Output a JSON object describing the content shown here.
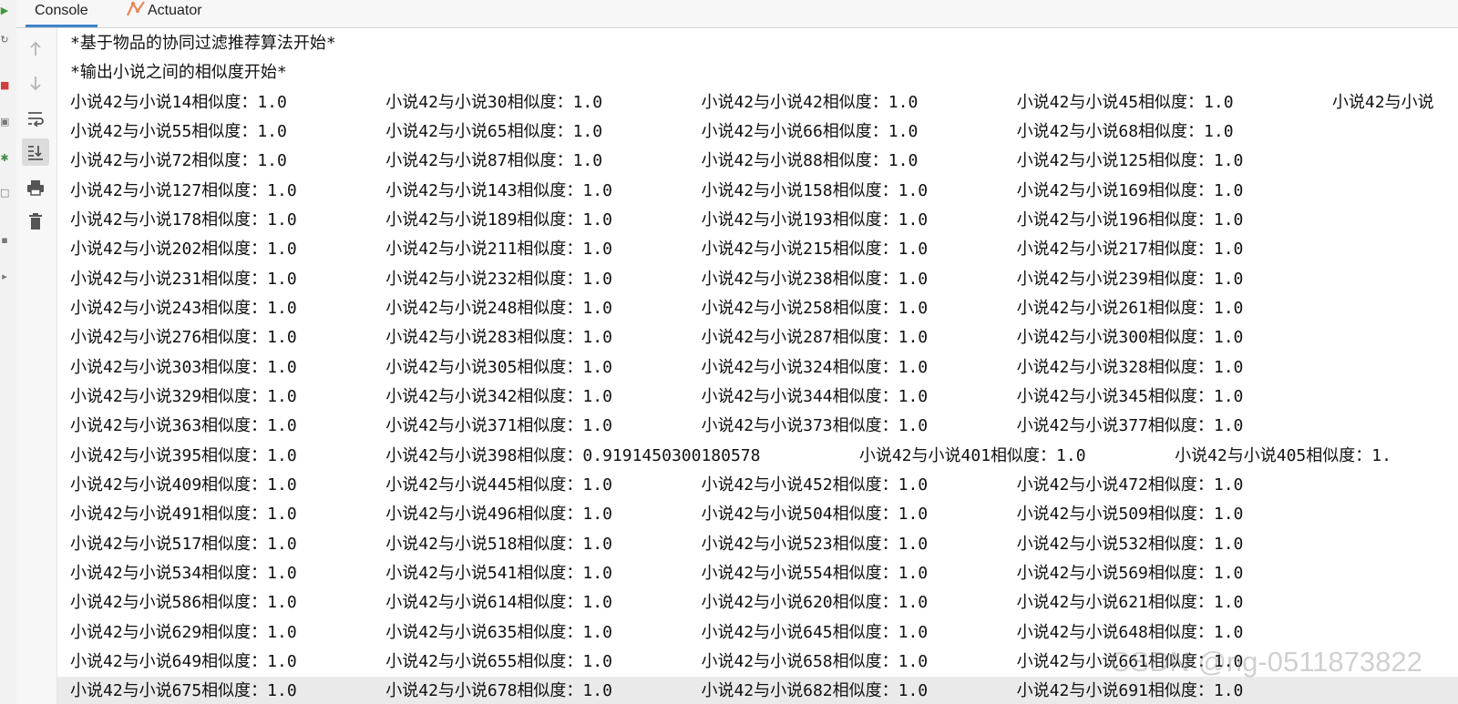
{
  "tabs": [
    {
      "label": "Console",
      "active": true,
      "icon": null
    },
    {
      "label": "Actuator",
      "active": false,
      "icon": "actuator-icon"
    }
  ],
  "toolbar": {
    "items": [
      {
        "name": "scroll-up-icon",
        "active": false
      },
      {
        "name": "scroll-down-icon",
        "active": false
      },
      {
        "name": "soft-wrap-icon",
        "active": false
      },
      {
        "name": "scroll-to-end-icon",
        "active": true
      },
      {
        "name": "print-icon",
        "active": false
      },
      {
        "name": "clear-all-icon",
        "active": false
      }
    ]
  },
  "console": {
    "lines": [
      "*基于物品的协同过滤推荐算法开始*",
      "*输出小说之间的相似度开始*",
      "小说42与小说14相似度：1.0          小说42与小说30相似度：1.0          小说42与小说42相似度：1.0          小说42与小说45相似度：1.0          小说42与小说",
      "小说42与小说55相似度：1.0          小说42与小说65相似度：1.0          小说42与小说66相似度：1.0          小说42与小说68相似度：1.0",
      "小说42与小说72相似度：1.0          小说42与小说87相似度：1.0          小说42与小说88相似度：1.0          小说42与小说125相似度：1.0",
      "小说42与小说127相似度：1.0         小说42与小说143相似度：1.0         小说42与小说158相似度：1.0         小说42与小说169相似度：1.0",
      "小说42与小说178相似度：1.0         小说42与小说189相似度：1.0         小说42与小说193相似度：1.0         小说42与小说196相似度：1.0",
      "小说42与小说202相似度：1.0         小说42与小说211相似度：1.0         小说42与小说215相似度：1.0         小说42与小说217相似度：1.0",
      "小说42与小说231相似度：1.0         小说42与小说232相似度：1.0         小说42与小说238相似度：1.0         小说42与小说239相似度：1.0",
      "小说42与小说243相似度：1.0         小说42与小说248相似度：1.0         小说42与小说258相似度：1.0         小说42与小说261相似度：1.0",
      "小说42与小说276相似度：1.0         小说42与小说283相似度：1.0         小说42与小说287相似度：1.0         小说42与小说300相似度：1.0",
      "小说42与小说303相似度：1.0         小说42与小说305相似度：1.0         小说42与小说324相似度：1.0         小说42与小说328相似度：1.0",
      "小说42与小说329相似度：1.0         小说42与小说342相似度：1.0         小说42与小说344相似度：1.0         小说42与小说345相似度：1.0",
      "小说42与小说363相似度：1.0         小说42与小说371相似度：1.0         小说42与小说373相似度：1.0         小说42与小说377相似度：1.0",
      "小说42与小说395相似度：1.0         小说42与小说398相似度：0.9191450300180578          小说42与小说401相似度：1.0         小说42与小说405相似度：1.",
      "小说42与小说409相似度：1.0         小说42与小说445相似度：1.0         小说42与小说452相似度：1.0         小说42与小说472相似度：1.0",
      "小说42与小说491相似度：1.0         小说42与小说496相似度：1.0         小说42与小说504相似度：1.0         小说42与小说509相似度：1.0",
      "小说42与小说517相似度：1.0         小说42与小说518相似度：1.0         小说42与小说523相似度：1.0         小说42与小说532相似度：1.0",
      "小说42与小说534相似度：1.0         小说42与小说541相似度：1.0         小说42与小说554相似度：1.0         小说42与小说569相似度：1.0",
      "小说42与小说586相似度：1.0         小说42与小说614相似度：1.0         小说42与小说620相似度：1.0         小说42与小说621相似度：1.0",
      "小说42与小说629相似度：1.0         小说42与小说635相似度：1.0         小说42与小说645相似度：1.0         小说42与小说648相似度：1.0",
      "小说42与小说649相似度：1.0         小说42与小说655相似度：1.0         小说42与小说658相似度：1.0         小说42与小说661相似度：1.0",
      "小说42与小说675相似度：1.0         小说42与小说678相似度：1.0         小说42与小说682相似度：1.0         小说42与小说691相似度：1.0"
    ],
    "highlighted_line": 22
  },
  "watermark": "CSDN @ng-0511873822"
}
